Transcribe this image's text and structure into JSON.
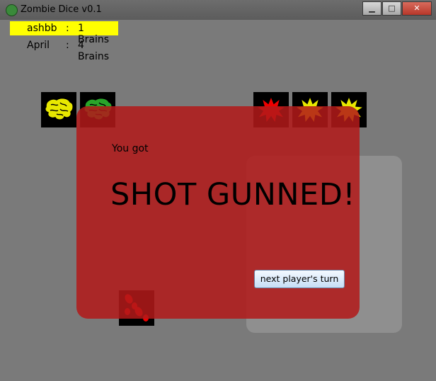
{
  "window": {
    "title": "Zombie Dice v0.1",
    "minimize": "▁",
    "maximize": "□",
    "close": "✕"
  },
  "scores": [
    {
      "name": "ashbb",
      "sep": ":",
      "value": "1 Brains",
      "active": true
    },
    {
      "name": "April",
      "sep": ":",
      "value": "4 Brains",
      "active": false
    }
  ],
  "dice": {
    "brains": [
      {
        "icon": "brain-icon",
        "color": "#e8e800"
      },
      {
        "icon": "brain-icon",
        "color": "#2aa52a"
      }
    ],
    "shotguns": [
      {
        "icon": "shotgun-blast-icon",
        "color": "#ee0000"
      },
      {
        "icon": "shotgun-blast-icon",
        "color": "#e8e800"
      },
      {
        "icon": "shotgun-blast-icon",
        "color": "#e8e800"
      }
    ],
    "footsteps": {
      "icon": "footsteps-icon",
      "color": "#ee0000"
    }
  },
  "popup": {
    "lead": "You got",
    "result": "SHOT GUNNED!",
    "bg_color": "#b21a1a"
  },
  "next_button": "next player's turn"
}
